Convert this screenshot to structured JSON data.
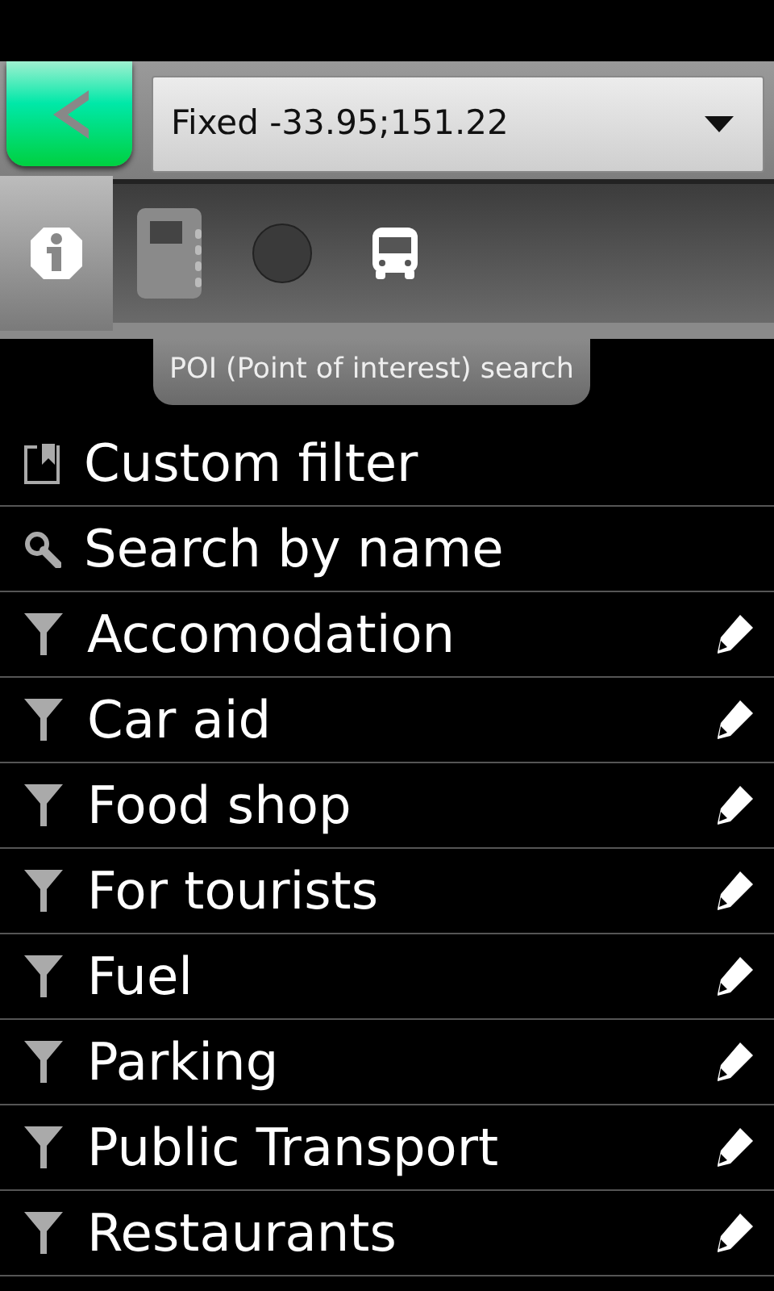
{
  "location": {
    "value": "Fixed -33.95;151.22"
  },
  "tabs": [
    {
      "kind": "info",
      "selected": true
    },
    {
      "kind": "notebook",
      "selected": false
    },
    {
      "kind": "circle",
      "selected": false
    },
    {
      "kind": "bus",
      "selected": false
    }
  ],
  "tooltip": "POI (Point of interest) search",
  "items": [
    {
      "kind": "custom",
      "label": "Custom filter",
      "editable": false
    },
    {
      "kind": "search",
      "label": "Search by name",
      "editable": false
    },
    {
      "kind": "filter",
      "label": "Accomodation",
      "editable": true
    },
    {
      "kind": "filter",
      "label": "Car aid",
      "editable": true
    },
    {
      "kind": "filter",
      "label": "Food shop",
      "editable": true
    },
    {
      "kind": "filter",
      "label": "For tourists",
      "editable": true
    },
    {
      "kind": "filter",
      "label": "Fuel",
      "editable": true
    },
    {
      "kind": "filter",
      "label": "Parking",
      "editable": true
    },
    {
      "kind": "filter",
      "label": "Public Transport",
      "editable": true
    },
    {
      "kind": "filter",
      "label": "Restaurants",
      "editable": true
    }
  ]
}
